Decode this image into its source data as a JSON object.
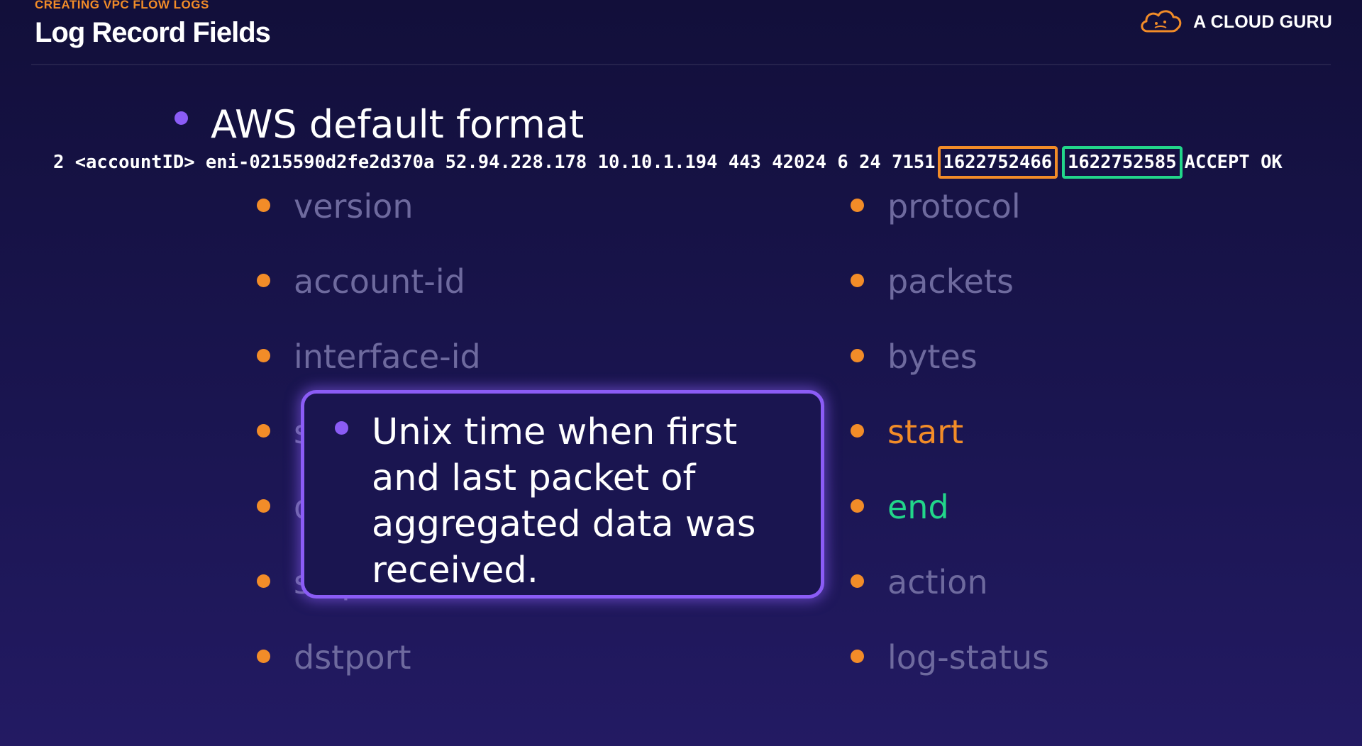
{
  "header": {
    "eyebrow": "CREATING VPC FLOW LOGS",
    "title": "Log Record Fields",
    "brand": {
      "name": "A CLOUD GURU",
      "icon": "cloud-logo-icon"
    }
  },
  "main": {
    "heading": "AWS default format",
    "log_line": {
      "prefix": "2 <accountID> eni-0215590d2fe2d370a 52.94.228.178 10.10.1.194 443 42024 6 24 7151",
      "start_value": "1622752466",
      "end_value": "1622752585",
      "suffix": "ACCEPT OK"
    },
    "left_fields": [
      {
        "label": "version"
      },
      {
        "label": "account-id"
      },
      {
        "label": "interface-id"
      },
      {
        "label": "srcaddr"
      },
      {
        "label": "dstaddr"
      },
      {
        "label": "srcport"
      },
      {
        "label": "dstport"
      }
    ],
    "right_fields": [
      {
        "label": "protocol"
      },
      {
        "label": "packets"
      },
      {
        "label": "bytes"
      },
      {
        "label": "start"
      },
      {
        "label": "end"
      },
      {
        "label": "action"
      },
      {
        "label": "log-status"
      }
    ],
    "callout": {
      "text": "Unix time when first and last packet of aggregated data was received."
    }
  },
  "colors": {
    "background": "#1a1550",
    "accent_orange": "#f28c28",
    "accent_green": "#22d68a",
    "accent_purple": "#8b5cf6",
    "muted_text": "#6e6a9e"
  }
}
